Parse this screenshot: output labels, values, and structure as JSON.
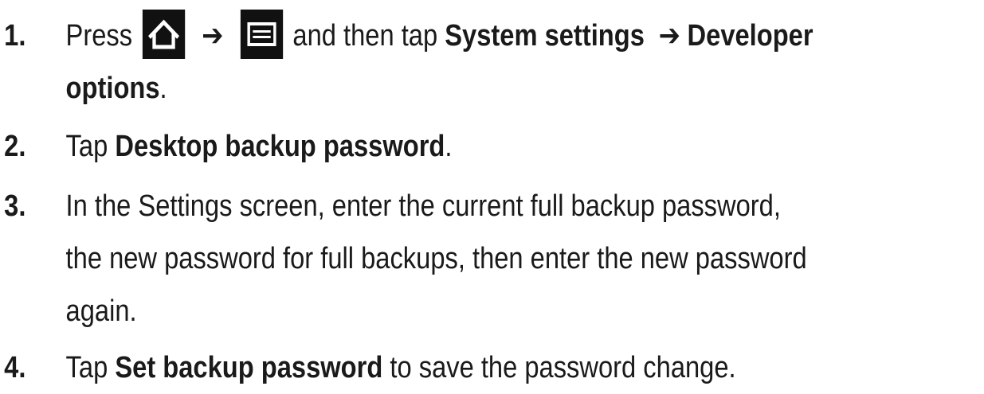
{
  "steps": [
    {
      "number": "1.",
      "press": "Press",
      "arrow1": "➔",
      "and_then_tap": "and then tap",
      "system_settings": "System settings",
      "arrow2": "➔",
      "developer": "Developer",
      "options": "options",
      "period": ".",
      "icons": [
        "home-icon",
        "menu-icon"
      ]
    },
    {
      "number": "2.",
      "tap": "Tap",
      "target": "Desktop backup password",
      "period": "."
    },
    {
      "number": "3.",
      "line1": "In the Settings screen, enter the current full backup password,",
      "line2": "the new password for full backups, then enter the new password",
      "line3": "again."
    },
    {
      "number": "4.",
      "tap": "Tap",
      "target": "Set backup password",
      "rest": "to save the password change."
    }
  ],
  "colors": {
    "text": "#1a1a1a",
    "icon_background": "#111111",
    "icon_foreground": "#ffffff"
  }
}
